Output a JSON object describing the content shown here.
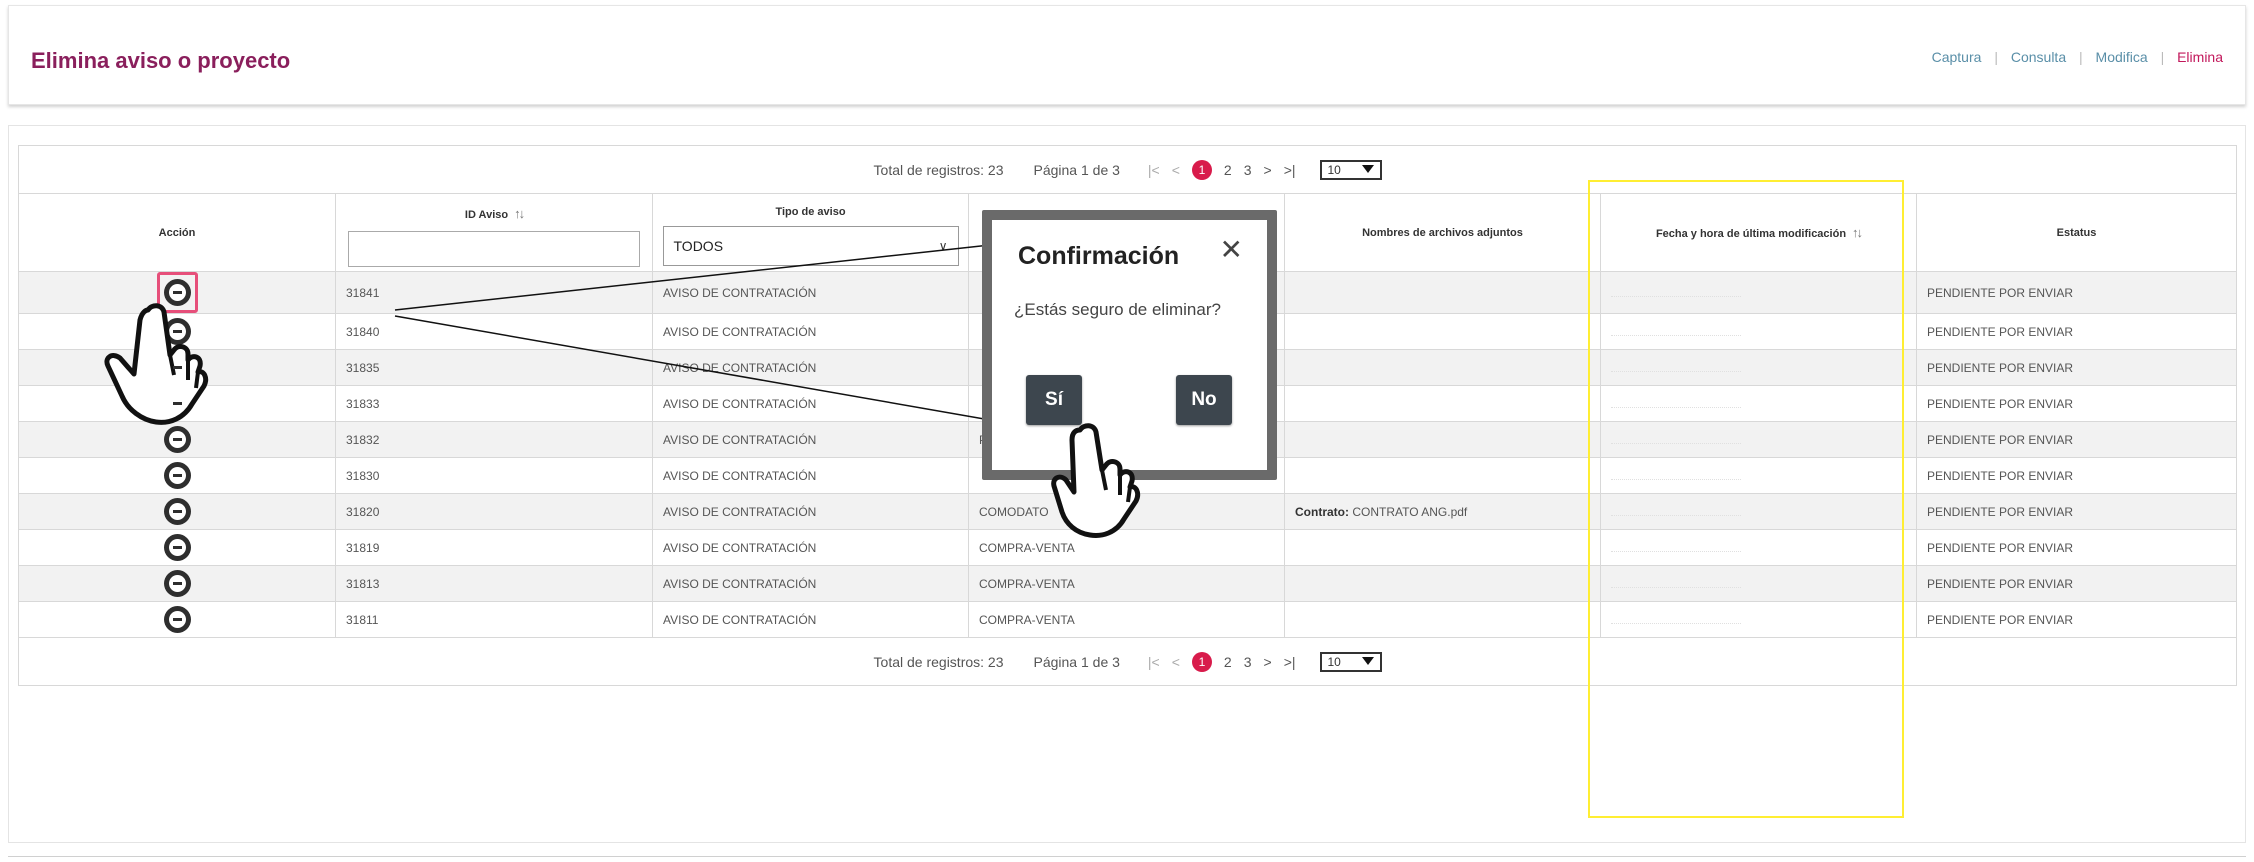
{
  "page": {
    "title": "Elimina aviso o proyecto",
    "nav": [
      {
        "label": "Captura",
        "active": false
      },
      {
        "label": "Consulta",
        "active": false
      },
      {
        "label": "Modifica",
        "active": false
      },
      {
        "label": "Elimina",
        "active": true
      }
    ],
    "nav_separator": "|",
    "accent_color": "#8a1f5c",
    "active_nav_color": "#c2185b"
  },
  "pager": {
    "total": "Total de registros: 23",
    "page_info": "Página 1 de 3",
    "first": "|<",
    "prev": "<",
    "pages": [
      "1",
      "2",
      "3"
    ],
    "next": ">",
    "last": ">|",
    "page_size": "10"
  },
  "columns": {
    "accion": "Acción",
    "id_aviso": "ID Aviso",
    "tipo_aviso": "Tipo de aviso",
    "archivos": "Nombres de archivos adjuntos",
    "fecha": "Fecha y hora de última modificación",
    "estatus": "Estatus"
  },
  "filters": {
    "id_placeholder": "",
    "tipo_selected": "TODOS"
  },
  "rows": [
    {
      "id": "31841",
      "tipo": "AVISO DE CONTRATACIÓN",
      "col4": "",
      "adjunto_label": "",
      "adjunto": "",
      "estatus": "PENDIENTE POR ENVIAR"
    },
    {
      "id": "31840",
      "tipo": "AVISO DE CONTRATACIÓN",
      "col4": "",
      "adjunto_label": "",
      "adjunto": "",
      "estatus": "PENDIENTE POR ENVIAR"
    },
    {
      "id": "31835",
      "tipo": "AVISO DE CONTRATACIÓN",
      "col4": "",
      "adjunto_label": "",
      "adjunto": "",
      "estatus": "PENDIENTE POR ENVIAR"
    },
    {
      "id": "31833",
      "tipo": "AVISO DE CONTRATACIÓN",
      "col4": "",
      "adjunto_label": "",
      "adjunto": "",
      "estatus": "PENDIENTE POR ENVIAR"
    },
    {
      "id": "31832",
      "tipo": "AVISO DE CONTRATACIÓN",
      "col4": "PRESTACIÓN",
      "adjunto_label": "",
      "adjunto": "",
      "estatus": "PENDIENTE POR ENVIAR"
    },
    {
      "id": "31830",
      "tipo": "AVISO DE CONTRATACIÓN",
      "col4": "",
      "adjunto_label": "",
      "adjunto": "",
      "estatus": "PENDIENTE POR ENVIAR"
    },
    {
      "id": "31820",
      "tipo": "AVISO DE CONTRATACIÓN",
      "col4": "COMODATO",
      "adjunto_label": "Contrato:",
      "adjunto": " CONTRATO ANG.pdf",
      "estatus": "PENDIENTE POR ENVIAR"
    },
    {
      "id": "31819",
      "tipo": "AVISO DE CONTRATACIÓN",
      "col4": "COMPRA-VENTA",
      "adjunto_label": "",
      "adjunto": "",
      "estatus": "PENDIENTE POR ENVIAR"
    },
    {
      "id": "31813",
      "tipo": "AVISO DE CONTRATACIÓN",
      "col4": "COMPRA-VENTA",
      "adjunto_label": "",
      "adjunto": "",
      "estatus": "PENDIENTE POR ENVIAR"
    },
    {
      "id": "31811",
      "tipo": "AVISO DE CONTRATACIÓN",
      "col4": "COMPRA-VENTA",
      "adjunto_label": "",
      "adjunto": "",
      "estatus": "PENDIENTE POR ENVIAR"
    }
  ],
  "dialog": {
    "title": "Confirmación",
    "close_symbol": "✕",
    "message": "¿Estás seguro de eliminar?",
    "yes_label": "Sí",
    "no_label": "No"
  },
  "annotations": {
    "highlight_color": "#ffee33",
    "row_highlight_color": "#e64f7a"
  }
}
